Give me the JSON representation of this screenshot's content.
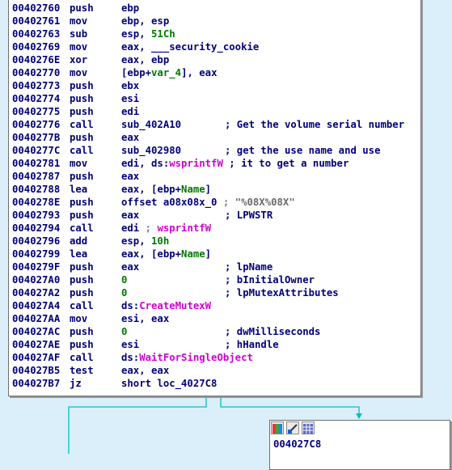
{
  "instructions": [
    {
      "addr": "00402760",
      "mnemonic": "push",
      "operand": [
        {
          "t": "ebp",
          "c": "c-name"
        }
      ],
      "comment": []
    },
    {
      "addr": "00402761",
      "mnemonic": "mov",
      "operand": [
        {
          "t": "ebp, esp",
          "c": "c-name"
        }
      ],
      "comment": []
    },
    {
      "addr": "00402763",
      "mnemonic": "sub",
      "operand": [
        {
          "t": "esp, ",
          "c": "c-name"
        },
        {
          "t": "51Ch",
          "c": "c-num"
        }
      ],
      "comment": []
    },
    {
      "addr": "00402769",
      "mnemonic": "mov",
      "operand": [
        {
          "t": "eax, ___security_cookie",
          "c": "c-name"
        }
      ],
      "comment": []
    },
    {
      "addr": "0040276E",
      "mnemonic": "xor",
      "operand": [
        {
          "t": "eax, ebp",
          "c": "c-name"
        }
      ],
      "comment": []
    },
    {
      "addr": "00402770",
      "mnemonic": "mov",
      "operand": [
        {
          "t": "[ebp+",
          "c": "c-name"
        },
        {
          "t": "var_4",
          "c": "c-var"
        },
        {
          "t": "], eax",
          "c": "c-name"
        }
      ],
      "comment": []
    },
    {
      "addr": "00402773",
      "mnemonic": "push",
      "operand": [
        {
          "t": "ebx",
          "c": "c-name"
        }
      ],
      "comment": []
    },
    {
      "addr": "00402774",
      "mnemonic": "push",
      "operand": [
        {
          "t": "esi",
          "c": "c-name"
        }
      ],
      "comment": []
    },
    {
      "addr": "00402775",
      "mnemonic": "push",
      "operand": [
        {
          "t": "edi",
          "c": "c-name"
        }
      ],
      "comment": []
    },
    {
      "addr": "00402776",
      "mnemonic": "call",
      "operand": [
        {
          "t": "sub_402A10",
          "c": "c-name"
        }
      ],
      "comment": [
        {
          "t": "; Get the volume serial number",
          "c": "c-cmt"
        }
      ]
    },
    {
      "addr": "0040277B",
      "mnemonic": "push",
      "operand": [
        {
          "t": "eax",
          "c": "c-name"
        }
      ],
      "comment": []
    },
    {
      "addr": "0040277C",
      "mnemonic": "call",
      "operand": [
        {
          "t": "sub_402980",
          "c": "c-name"
        }
      ],
      "comment": [
        {
          "t": "; get the use name and use",
          "c": "c-cmt"
        }
      ]
    },
    {
      "addr": "00402781",
      "mnemonic": "mov",
      "operand": [
        {
          "t": "edi, ds:",
          "c": "c-name"
        },
        {
          "t": "wsprintfW",
          "c": "c-imp"
        },
        {
          "t": " ; it to get a number",
          "c": "c-cmt"
        }
      ],
      "comment": []
    },
    {
      "addr": "00402787",
      "mnemonic": "push",
      "operand": [
        {
          "t": "eax",
          "c": "c-name"
        }
      ],
      "comment": []
    },
    {
      "addr": "00402788",
      "mnemonic": "lea",
      "operand": [
        {
          "t": "eax, [ebp+",
          "c": "c-name"
        },
        {
          "t": "Name",
          "c": "c-var"
        },
        {
          "t": "]",
          "c": "c-name"
        }
      ],
      "comment": []
    },
    {
      "addr": "0040278E",
      "mnemonic": "push",
      "operand": [
        {
          "t": "offset a08x08x_0",
          "c": "c-name"
        },
        {
          "t": " ; ",
          "c": "c-semi"
        },
        {
          "t": "\"%08X%08X\"",
          "c": "c-str"
        }
      ],
      "comment": []
    },
    {
      "addr": "00402793",
      "mnemonic": "push",
      "operand": [
        {
          "t": "eax",
          "c": "c-name"
        }
      ],
      "comment": [
        {
          "t": "; LPWSTR",
          "c": "c-cmt"
        }
      ]
    },
    {
      "addr": "00402794",
      "mnemonic": "call",
      "operand": [
        {
          "t": "edi",
          "c": "c-name"
        },
        {
          "t": " ; ",
          "c": "c-semi"
        },
        {
          "t": "wsprintfW",
          "c": "c-imp"
        }
      ],
      "comment": []
    },
    {
      "addr": "00402796",
      "mnemonic": "add",
      "operand": [
        {
          "t": "esp, ",
          "c": "c-name"
        },
        {
          "t": "10h",
          "c": "c-num"
        }
      ],
      "comment": []
    },
    {
      "addr": "00402799",
      "mnemonic": "lea",
      "operand": [
        {
          "t": "eax, [ebp+",
          "c": "c-name"
        },
        {
          "t": "Name",
          "c": "c-var"
        },
        {
          "t": "]",
          "c": "c-name"
        }
      ],
      "comment": []
    },
    {
      "addr": "0040279F",
      "mnemonic": "push",
      "operand": [
        {
          "t": "eax",
          "c": "c-name"
        }
      ],
      "comment": [
        {
          "t": "; lpName",
          "c": "c-cmt"
        }
      ]
    },
    {
      "addr": "004027A0",
      "mnemonic": "push",
      "operand": [
        {
          "t": "0",
          "c": "c-num"
        }
      ],
      "comment": [
        {
          "t": "; bInitialOwner",
          "c": "c-cmt"
        }
      ]
    },
    {
      "addr": "004027A2",
      "mnemonic": "push",
      "operand": [
        {
          "t": "0",
          "c": "c-num"
        }
      ],
      "comment": [
        {
          "t": "; lpMutexAttributes",
          "c": "c-cmt"
        }
      ]
    },
    {
      "addr": "004027A4",
      "mnemonic": "call",
      "operand": [
        {
          "t": "ds:",
          "c": "c-name"
        },
        {
          "t": "CreateMutexW",
          "c": "c-imp"
        }
      ],
      "comment": []
    },
    {
      "addr": "004027AA",
      "mnemonic": "mov",
      "operand": [
        {
          "t": "esi, eax",
          "c": "c-name"
        }
      ],
      "comment": []
    },
    {
      "addr": "004027AC",
      "mnemonic": "push",
      "operand": [
        {
          "t": "0",
          "c": "c-num"
        }
      ],
      "comment": [
        {
          "t": "; dwMilliseconds",
          "c": "c-cmt"
        }
      ]
    },
    {
      "addr": "004027AE",
      "mnemonic": "push",
      "operand": [
        {
          "t": "esi",
          "c": "c-name"
        }
      ],
      "comment": [
        {
          "t": "; hHandle",
          "c": "c-cmt"
        }
      ]
    },
    {
      "addr": "004027AF",
      "mnemonic": "call",
      "operand": [
        {
          "t": "ds:",
          "c": "c-name"
        },
        {
          "t": "WaitForSingleObject",
          "c": "c-imp"
        }
      ],
      "comment": []
    },
    {
      "addr": "004027B5",
      "mnemonic": "test",
      "operand": [
        {
          "t": "eax, eax",
          "c": "c-name"
        }
      ],
      "comment": []
    },
    {
      "addr": "004027B7",
      "mnemonic": "jz",
      "operand": [
        {
          "t": "short loc_4027C8",
          "c": "c-name"
        }
      ],
      "comment": []
    }
  ],
  "target_node": {
    "label": "004027C8",
    "toolbar": [
      "palette-icon",
      "edit-graph-icon",
      "grid-icon"
    ]
  },
  "colors": {
    "background": "#dbeffa",
    "edge": "#00c0c0",
    "text": "#00007a",
    "immediate": "#007800",
    "import": "#d000d0"
  }
}
